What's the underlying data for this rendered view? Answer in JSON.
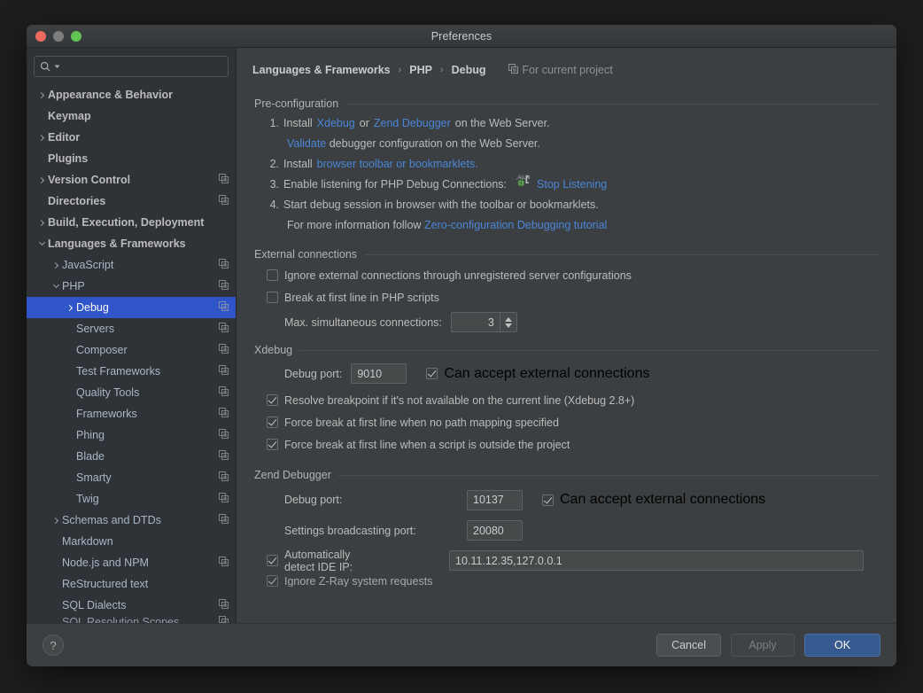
{
  "window": {
    "title": "Preferences"
  },
  "search": {
    "placeholder": "",
    "value": "",
    "icon": "search-icon"
  },
  "sidebar": {
    "items": [
      {
        "label": "Appearance & Behavior",
        "indent": 0,
        "arrow": "right",
        "bold": true,
        "scope": false
      },
      {
        "label": "Keymap",
        "indent": 0,
        "arrow": "none",
        "bold": true,
        "scope": false
      },
      {
        "label": "Editor",
        "indent": 0,
        "arrow": "right",
        "bold": true,
        "scope": false
      },
      {
        "label": "Plugins",
        "indent": 0,
        "arrow": "none",
        "bold": true,
        "scope": false
      },
      {
        "label": "Version Control",
        "indent": 0,
        "arrow": "right",
        "bold": true,
        "scope": true
      },
      {
        "label": "Directories",
        "indent": 0,
        "arrow": "none",
        "bold": true,
        "scope": true
      },
      {
        "label": "Build, Execution, Deployment",
        "indent": 0,
        "arrow": "right",
        "bold": true,
        "scope": false
      },
      {
        "label": "Languages & Frameworks",
        "indent": 0,
        "arrow": "down",
        "bold": true,
        "scope": false
      },
      {
        "label": "JavaScript",
        "indent": 1,
        "arrow": "right",
        "bold": false,
        "scope": true
      },
      {
        "label": "PHP",
        "indent": 1,
        "arrow": "down",
        "bold": false,
        "scope": true
      },
      {
        "label": "Debug",
        "indent": 2,
        "arrow": "right",
        "bold": false,
        "scope": true,
        "selected": true
      },
      {
        "label": "Servers",
        "indent": 2,
        "arrow": "none",
        "bold": false,
        "scope": true
      },
      {
        "label": "Composer",
        "indent": 2,
        "arrow": "none",
        "bold": false,
        "scope": true
      },
      {
        "label": "Test Frameworks",
        "indent": 2,
        "arrow": "none",
        "bold": false,
        "scope": true
      },
      {
        "label": "Quality Tools",
        "indent": 2,
        "arrow": "none",
        "bold": false,
        "scope": true
      },
      {
        "label": "Frameworks",
        "indent": 2,
        "arrow": "none",
        "bold": false,
        "scope": true
      },
      {
        "label": "Phing",
        "indent": 2,
        "arrow": "none",
        "bold": false,
        "scope": true
      },
      {
        "label": "Blade",
        "indent": 2,
        "arrow": "none",
        "bold": false,
        "scope": true
      },
      {
        "label": "Smarty",
        "indent": 2,
        "arrow": "none",
        "bold": false,
        "scope": true
      },
      {
        "label": "Twig",
        "indent": 2,
        "arrow": "none",
        "bold": false,
        "scope": true
      },
      {
        "label": "Schemas and DTDs",
        "indent": 1,
        "arrow": "right",
        "bold": false,
        "scope": true
      },
      {
        "label": "Markdown",
        "indent": 1,
        "arrow": "none",
        "bold": false,
        "scope": false
      },
      {
        "label": "Node.js and NPM",
        "indent": 1,
        "arrow": "none",
        "bold": false,
        "scope": true
      },
      {
        "label": "ReStructured text",
        "indent": 1,
        "arrow": "none",
        "bold": false,
        "scope": false
      },
      {
        "label": "SQL Dialects",
        "indent": 1,
        "arrow": "none",
        "bold": false,
        "scope": true
      },
      {
        "label": "SQL Resolution Scopes",
        "indent": 1,
        "arrow": "none",
        "bold": false,
        "scope": true,
        "cut": true
      }
    ]
  },
  "breadcrumb": {
    "crumb1": "Languages & Frameworks",
    "sep": "›",
    "crumb2": "PHP",
    "crumb3": "Debug",
    "scope_label": "For current project"
  },
  "preconfiguration": {
    "title": "Pre-configuration",
    "item1": {
      "num": "1.",
      "pre": "Install",
      "link1": "Xdebug",
      "mid": "or",
      "link2": "Zend Debugger",
      "post": "on the Web Server."
    },
    "item1_sub": {
      "link": "Validate",
      "post": "debugger configuration on the Web Server."
    },
    "item2": {
      "num": "2.",
      "pre": "Install",
      "link": "browser toolbar or bookmarklets."
    },
    "item3": {
      "num": "3.",
      "pre": "Enable listening for PHP Debug Connections:",
      "link": "Stop Listening",
      "icon": "bug-listening-icon"
    },
    "item4": {
      "num": "4.",
      "text": "Start debug session in browser with the toolbar or bookmarklets."
    },
    "item4_sub": {
      "pre": "For more information follow",
      "link": "Zero-configuration Debugging tutorial"
    }
  },
  "external_connections": {
    "title": "External connections",
    "ignore_external": {
      "label": "Ignore external connections through unregistered server configurations",
      "checked": false
    },
    "break_first_line": {
      "label": "Break at first line in PHP scripts",
      "checked": false
    },
    "max_connections": {
      "label": "Max. simultaneous connections:",
      "value": "3"
    }
  },
  "xdebug": {
    "title": "Xdebug",
    "debug_port_label": "Debug port:",
    "debug_port_value": "9010",
    "accept_external": {
      "label": "Can accept external connections",
      "checked": true
    },
    "resolve_breakpoint": {
      "label": "Resolve breakpoint if it's not available on the current line (Xdebug 2.8+)",
      "checked": true
    },
    "force_break_no_path": {
      "label": "Force break at first line when no path mapping specified",
      "checked": true
    },
    "force_break_outside": {
      "label": "Force break at first line when a script is outside the project",
      "checked": true
    }
  },
  "zend_debugger": {
    "title": "Zend Debugger",
    "debug_port_label": "Debug port:",
    "debug_port_value": "10137",
    "accept_external": {
      "label": "Can accept external connections",
      "checked": true
    },
    "broadcast_port_label": "Settings broadcasting port:",
    "broadcast_port_value": "20080",
    "auto_detect_ip": {
      "label": "Automatically detect IDE IP:",
      "checked": true
    },
    "ip_value": "10.11.12.35,127.0.0.1",
    "ignore_zray": {
      "label": "Ignore Z-Ray system requests",
      "checked": true
    }
  },
  "footer": {
    "help": "?",
    "cancel": "Cancel",
    "apply": "Apply",
    "ok": "OK"
  },
  "colors": {
    "selection_blue": "#2f55c9",
    "link_blue": "#4a86d8",
    "primary_button": "#36598f",
    "panel_bg": "#3c3f41",
    "sidebar_bg": "#2f3237",
    "bug_green": "#5a9e4b"
  }
}
